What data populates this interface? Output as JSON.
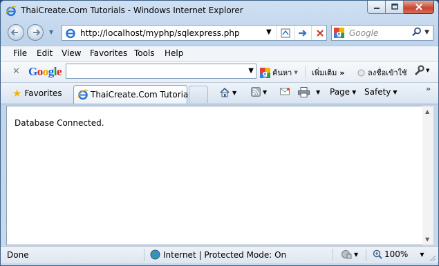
{
  "window": {
    "title": "ThaiCreate.Com Tutorials - Windows Internet Explorer"
  },
  "address_bar": {
    "url": "http://localhost/myphp/sqlexpress.php"
  },
  "search_box": {
    "placeholder": "Google"
  },
  "menu": {
    "items": [
      "File",
      "Edit",
      "View",
      "Favorites",
      "Tools",
      "Help"
    ]
  },
  "google_toolbar": {
    "logo": "Google",
    "search_label": "ค้นหา",
    "more_label": "เพิ่มเติม",
    "signin_label": "ลงชื่อเข้าใช้"
  },
  "tabs": {
    "favorites_label": "Favorites",
    "active_tab_label": "ThaiCreate.Com Tutorials"
  },
  "command_bar": {
    "page_label": "Page",
    "safety_label": "Safety"
  },
  "content": {
    "message": "Database Connected."
  },
  "status_bar": {
    "status": "Done",
    "zone": "Internet | Protected Mode: On",
    "zoom": "100%"
  },
  "colors": {
    "google_blue": "#1a5fd8",
    "google_red": "#d6281c",
    "google_yellow": "#e9a400",
    "google_green": "#1e9a38"
  }
}
